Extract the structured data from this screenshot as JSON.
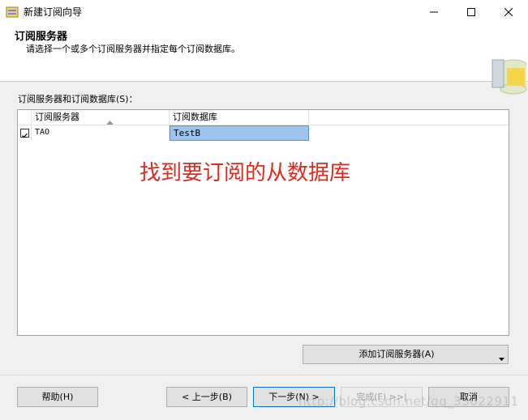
{
  "window": {
    "title": "新建订阅向导",
    "icon": "wizard-icon"
  },
  "header": {
    "title": "订阅服务器",
    "subtitle": "请选择一个或多个订阅服务器并指定每个订阅数据库。",
    "graphic": "database-graphic"
  },
  "grid_section": {
    "label": "订阅服务器和订阅数据库(S)："
  },
  "grid": {
    "columns": [
      "订阅服务器",
      "订阅数据库"
    ],
    "rows": [
      {
        "checked": true,
        "server": "TAO",
        "database": "TestB"
      }
    ]
  },
  "annotation": "找到要订阅的从数据库",
  "buttons": {
    "add_subscriber": "添加订阅服务器(A)",
    "help": "帮助(H)",
    "back": "< 上一步(B)",
    "next": "下一步(N) >",
    "finish": "完成(F) >>|",
    "cancel": "取消"
  },
  "watermark": "http://blog.csdn.net/qq_33022911",
  "colors": {
    "selection": "#9dc5ef",
    "annotation": "#e02a1e",
    "focus_border": "#0078d7"
  }
}
